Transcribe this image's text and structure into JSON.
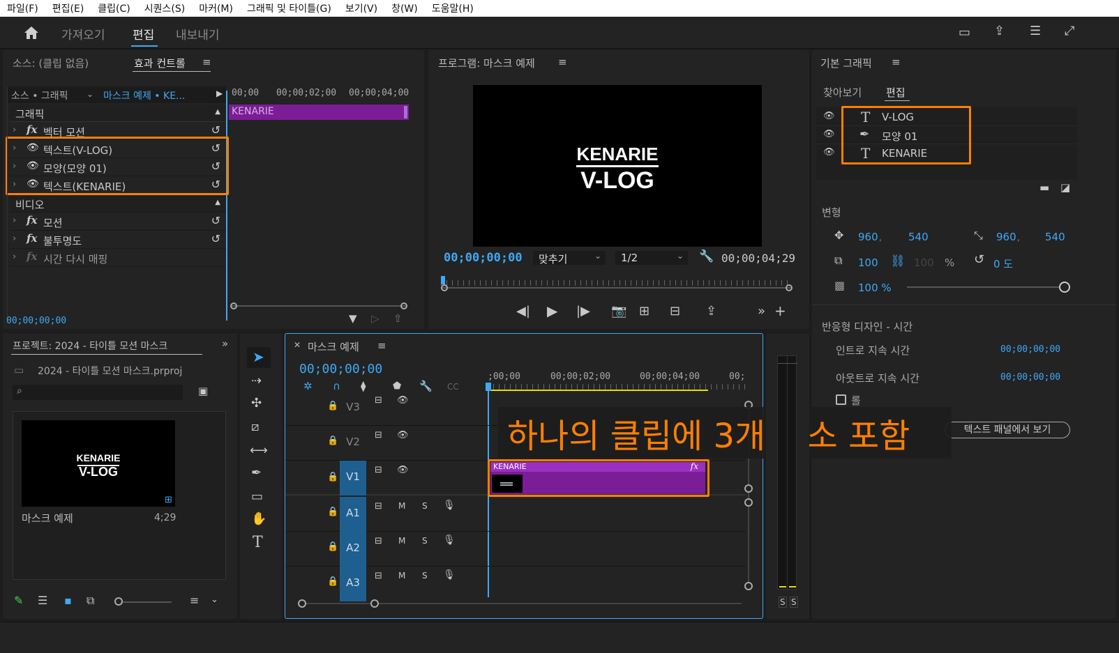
{
  "menu": [
    "파일(F)",
    "편집(E)",
    "클립(C)",
    "시퀀스(S)",
    "마커(M)",
    "그래픽 및 타이틀(G)",
    "보기(V)",
    "창(W)",
    "도움말(H)"
  ],
  "workspace_tabs": {
    "import": "가져오기",
    "edit": "편집",
    "export": "내보내기"
  },
  "source_panel": {
    "source_tab": "소스: (클립 없음)",
    "effect_controls_tab": "효과 컨트롤",
    "menu_glyph": "≡",
    "clip_path_prefix": "소스 • 그래픽",
    "clip_path_sequence": "마스크 예제 • KE...",
    "ruler": [
      "00;00",
      "00;00;02;00",
      "00;00;04;00"
    ],
    "clip_name": "KENARIE",
    "section_graphic": "그래픽",
    "rows_graphic": [
      "벡터 모션",
      "텍스트(V-LOG)",
      "모양(모양 01)",
      "텍스트(KENARIE)"
    ],
    "section_video": "비디오",
    "rows_video": [
      "모션",
      "불투명도",
      "시간 다시 매핑"
    ],
    "timecode": "00;00;00;00"
  },
  "program_monitor": {
    "title": "프로그램: 마스크 예제",
    "frame_line1": "KENARIE",
    "frame_line2": "V-LOG",
    "timecode": "00;00;00;00",
    "fit": "맞추기",
    "resolution": "1/2",
    "duration": "00;00;04;29"
  },
  "essential_graphics": {
    "title": "기본 그래픽",
    "tab_browse": "찾아보기",
    "tab_edit": "편집",
    "layers": [
      "V-LOG",
      "모양 01",
      "KENARIE"
    ],
    "transform_label": "변형",
    "pos_x": "960",
    "pos_y": "540",
    "anchor_x": "960",
    "anchor_y": "540",
    "scale": "100",
    "scale_width": "100",
    "percent": "%",
    "rotation": "0 도",
    "opacity": "100 %",
    "responsive_title": "반응형 디자인 - 시간",
    "intro_label": "인트로 지속 시간",
    "intro_value": "00;00;00;00",
    "outro_label": "아웃트로 지속 시간",
    "outro_value": "00;00;00;00",
    "roll_label": "롤",
    "view_button": "텍스트 패널에서 보기"
  },
  "project_panel": {
    "title": "프로젝트: 2024 - 타이틀 모션 마스크",
    "file": "2024 - 타이틀 모션 마스크.prproj",
    "search_placeholder": "",
    "thumb_line1": "KENARIE",
    "thumb_line2": "V-LOG",
    "item_name": "마스크 예제",
    "item_duration": "4;29"
  },
  "timeline": {
    "title": "마스크 예제",
    "timecode": "00;00;00;00",
    "ruler": [
      ";00;00",
      "00;00;02;00",
      "00;00;04;00",
      "00;"
    ],
    "tracks": [
      "V3",
      "V2",
      "V1",
      "A1",
      "A2",
      "A3"
    ],
    "m_label": "M",
    "s_label": "S",
    "clip_name": "KENARIE",
    "fx_label": "fx"
  },
  "annotation": "하나의 클립에 3개 요소 포함",
  "meter_labels": [
    "S",
    "S"
  ],
  "colors": {
    "accent": "#3fa9f5",
    "highlight": "#ff7f00",
    "clip": "#7b1d96",
    "clip_header": "#9b2fbf"
  }
}
